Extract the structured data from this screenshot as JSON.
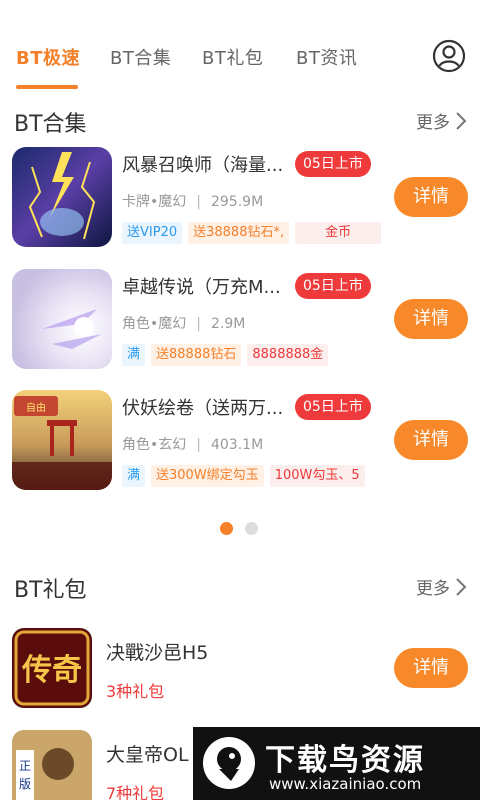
{
  "tabs": [
    {
      "label": "BT极速",
      "active": true
    },
    {
      "label": "BT合集",
      "active": false
    },
    {
      "label": "BT礼包",
      "active": false
    },
    {
      "label": "BT资讯",
      "active": false
    }
  ],
  "colors": {
    "accent": "#f5802a",
    "badge": "#ee3a3a",
    "tag_blue": "#2b9bee"
  },
  "bt_collection": {
    "title": "BT合集",
    "more": "更多",
    "games": [
      {
        "name": "风暴召唤师（海量...",
        "badge": "05日上市",
        "category": "卡牌•魔幻",
        "size": "295.9M",
        "tags": [
          {
            "text": "送VIP20",
            "style": "blue"
          },
          {
            "text": "送38888钻石*,",
            "style": "orange"
          },
          {
            "text": "金币",
            "style": "red"
          }
        ],
        "button": "详情"
      },
      {
        "name": "卓越传说（万充M...",
        "badge": "05日上市",
        "category": "角色•魔幻",
        "size": "2.9M",
        "tags": [
          {
            "text": "满",
            "style": "blue"
          },
          {
            "text": "送88888钻石",
            "style": "orange"
          },
          {
            "text": "8888888金",
            "style": "red"
          }
        ],
        "button": "详情"
      },
      {
        "name": "伏妖绘卷（送两万...",
        "badge": "05日上市",
        "category": "角色•玄幻",
        "size": "403.1M",
        "tags": [
          {
            "text": "满",
            "style": "blue"
          },
          {
            "text": "送300W绑定勾玉",
            "style": "orange"
          },
          {
            "text": "100W勾玉、5",
            "style": "red"
          }
        ],
        "button": "详情"
      }
    ],
    "carousel": {
      "pages": 2,
      "current": 1
    }
  },
  "bt_gifts": {
    "title": "BT礼包",
    "more": "更多",
    "games": [
      {
        "name": "决戰沙邑H5",
        "gift_count": "3种礼包",
        "button": "详情"
      },
      {
        "name": "大皇帝OL",
        "gift_count": "7种礼包"
      }
    ]
  },
  "watermark": {
    "title": "下载鸟资源",
    "url": "www.xiazainiao.com"
  }
}
